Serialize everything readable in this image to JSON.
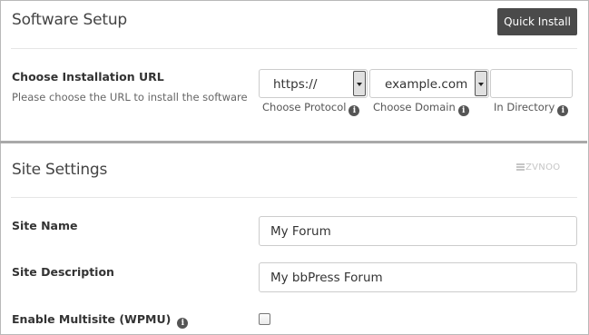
{
  "software_setup": {
    "title": "Software Setup",
    "quick_install_label": "Quick Install"
  },
  "install_url": {
    "label": "Choose Installation URL",
    "description": "Please choose the URL to install the software",
    "protocol": {
      "value": "https://",
      "caption": "Choose Protocol"
    },
    "domain": {
      "value": "example.com",
      "caption": "Choose Domain"
    },
    "directory": {
      "value": "",
      "caption": "In Directory"
    }
  },
  "site_settings": {
    "title": "Site Settings",
    "watermark": "ZVNOO",
    "site_name": {
      "label": "Site Name",
      "value": "My Forum"
    },
    "site_description": {
      "label": "Site Description",
      "value": "My bbPress Forum"
    },
    "multisite": {
      "label": "Enable Multisite (WPMU)",
      "checked": false
    }
  },
  "colors": {
    "button_bg": "#4a4a4a",
    "section_divider": "#a9a9a9",
    "border": "#cccccc"
  },
  "icons": [
    "info-icon",
    "chevron-down-icon",
    "checkbox"
  ]
}
